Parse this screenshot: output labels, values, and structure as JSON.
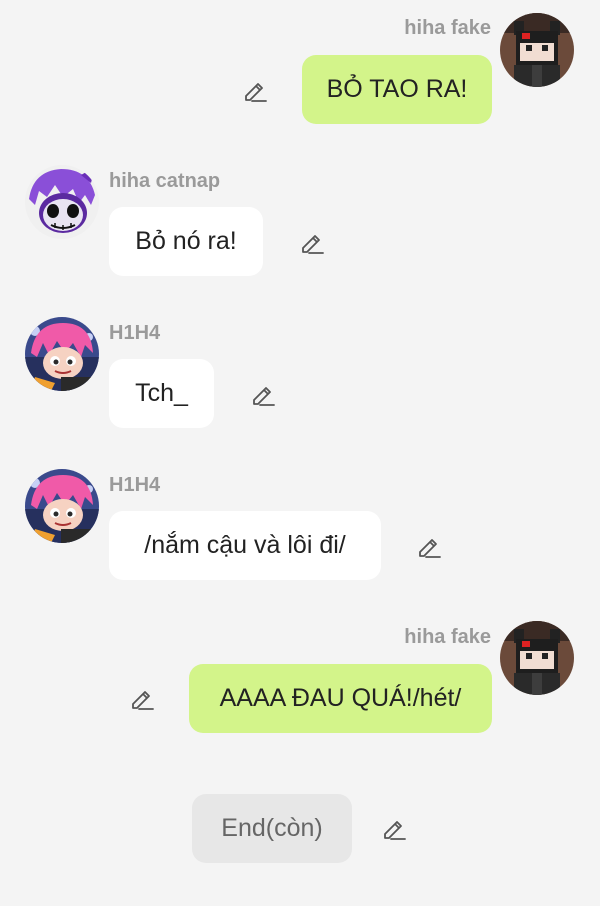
{
  "messages": [
    {
      "sender": "hiha fake",
      "text": "BỎ TAO RA!",
      "side": "right",
      "edit_icon": "pencil-icon"
    },
    {
      "sender": "hiha catnap",
      "text": "Bỏ nó ra!",
      "side": "left",
      "edit_icon": "pencil-icon"
    },
    {
      "sender": "H1H4",
      "text": "Tch_",
      "side": "left",
      "edit_icon": "pencil-icon"
    },
    {
      "sender": "H1H4",
      "text": "/nắm cậu và lôi đi/",
      "side": "left",
      "edit_icon": "pencil-icon"
    },
    {
      "sender": "hiha fake",
      "text": "AAAA ĐAU QUÁ!/hét/",
      "side": "right",
      "edit_icon": "pencil-icon"
    },
    {
      "sender": "",
      "text": "End(còn)",
      "side": "center",
      "edit_icon": "pencil-icon"
    }
  ],
  "colors": {
    "background": "#f4f4f4",
    "outgoing_bubble": "#d3f48a",
    "incoming_bubble": "#ffffff",
    "narration_bubble": "#e7e7e7",
    "name_text": "#9a9a9a"
  }
}
